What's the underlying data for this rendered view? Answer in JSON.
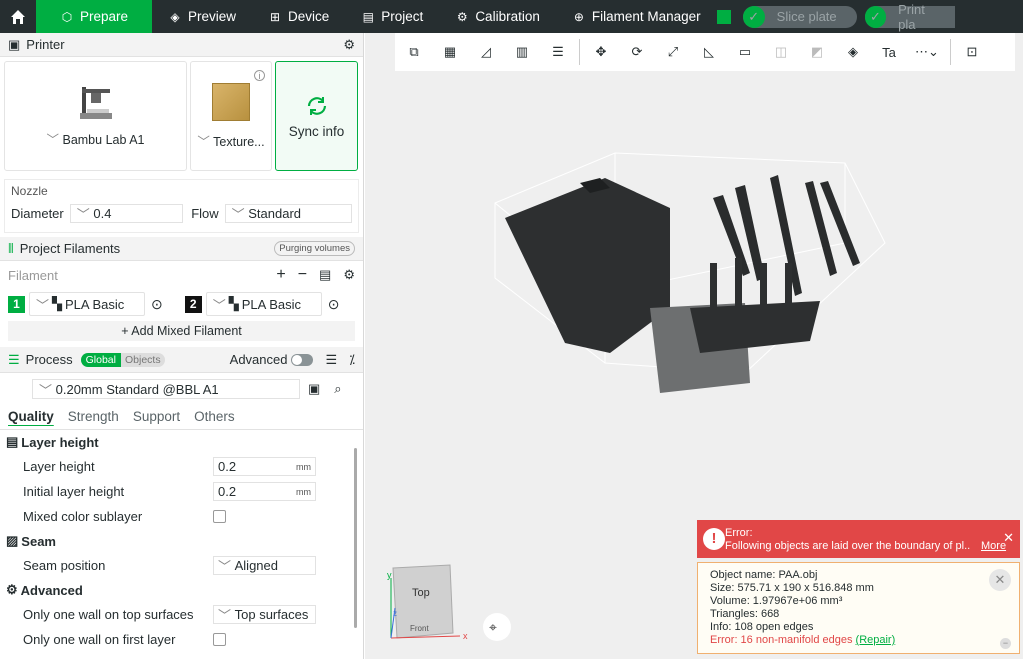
{
  "topbar": {
    "tabs": [
      {
        "label": "Prepare",
        "icon": "cube-icon"
      },
      {
        "label": "Preview",
        "icon": "layers-icon"
      },
      {
        "label": "Device",
        "icon": "device-icon"
      },
      {
        "label": "Project",
        "icon": "project-icon"
      },
      {
        "label": "Calibration",
        "icon": "calibration-icon"
      },
      {
        "label": "Filament Manager",
        "icon": "filament-manager-icon"
      }
    ],
    "slice_label": "Slice plate",
    "print_label": "Print pla"
  },
  "printer": {
    "header": "Printer",
    "name": "Bambu Lab A1",
    "plate": "Texture...",
    "sync": "Sync info",
    "nozzle_label": "Nozzle",
    "diameter_label": "Diameter",
    "diameter_value": "0.4",
    "flow_label": "Flow",
    "flow_value": "Standard"
  },
  "filaments": {
    "header": "Project Filaments",
    "purging": "Purging volumes",
    "label": "Filament",
    "items": [
      {
        "num": "1",
        "name": "PLA Basic",
        "color": "#00ae42"
      },
      {
        "num": "2",
        "name": "PLA Basic",
        "color": "#111111"
      }
    ],
    "add_mixed": "+ Add Mixed Filament"
  },
  "process": {
    "header": "Process",
    "global": "Global",
    "objects": "Objects",
    "advanced": "Advanced",
    "preset": "0.20mm Standard @BBL A1",
    "tabs": [
      "Quality",
      "Strength",
      "Support",
      "Others"
    ]
  },
  "settings": {
    "layer_height_group": "Layer height",
    "layer_height_label": "Layer height",
    "layer_height_value": "0.2",
    "initial_layer_label": "Initial layer height",
    "initial_layer_value": "0.2",
    "unit": "mm",
    "mixed_color_label": "Mixed color sublayer",
    "seam_group": "Seam",
    "seam_position_label": "Seam position",
    "seam_position_value": "Aligned",
    "advanced_group": "Advanced",
    "one_wall_top_label": "Only one wall on top surfaces",
    "one_wall_top_value": "Top surfaces",
    "one_wall_first_label": "Only one wall on first layer"
  },
  "viewcube": {
    "top": "Top",
    "front": "Front",
    "x": "x",
    "y": "y",
    "z": "z"
  },
  "error": {
    "title": "Error:",
    "message": "Following objects are laid over the boundary of pl..",
    "more": "More"
  },
  "info": {
    "name": "Object name: PAA.obj",
    "size": "Size: 575.71 x 190 x 516.848 mm",
    "volume": "Volume: 1.97967e+06 mm³",
    "triangles": "Triangles: 668",
    "edges": "Info: 108 open edges",
    "error": "Error: 16 non-manifold edges",
    "repair": "(Repair)"
  }
}
